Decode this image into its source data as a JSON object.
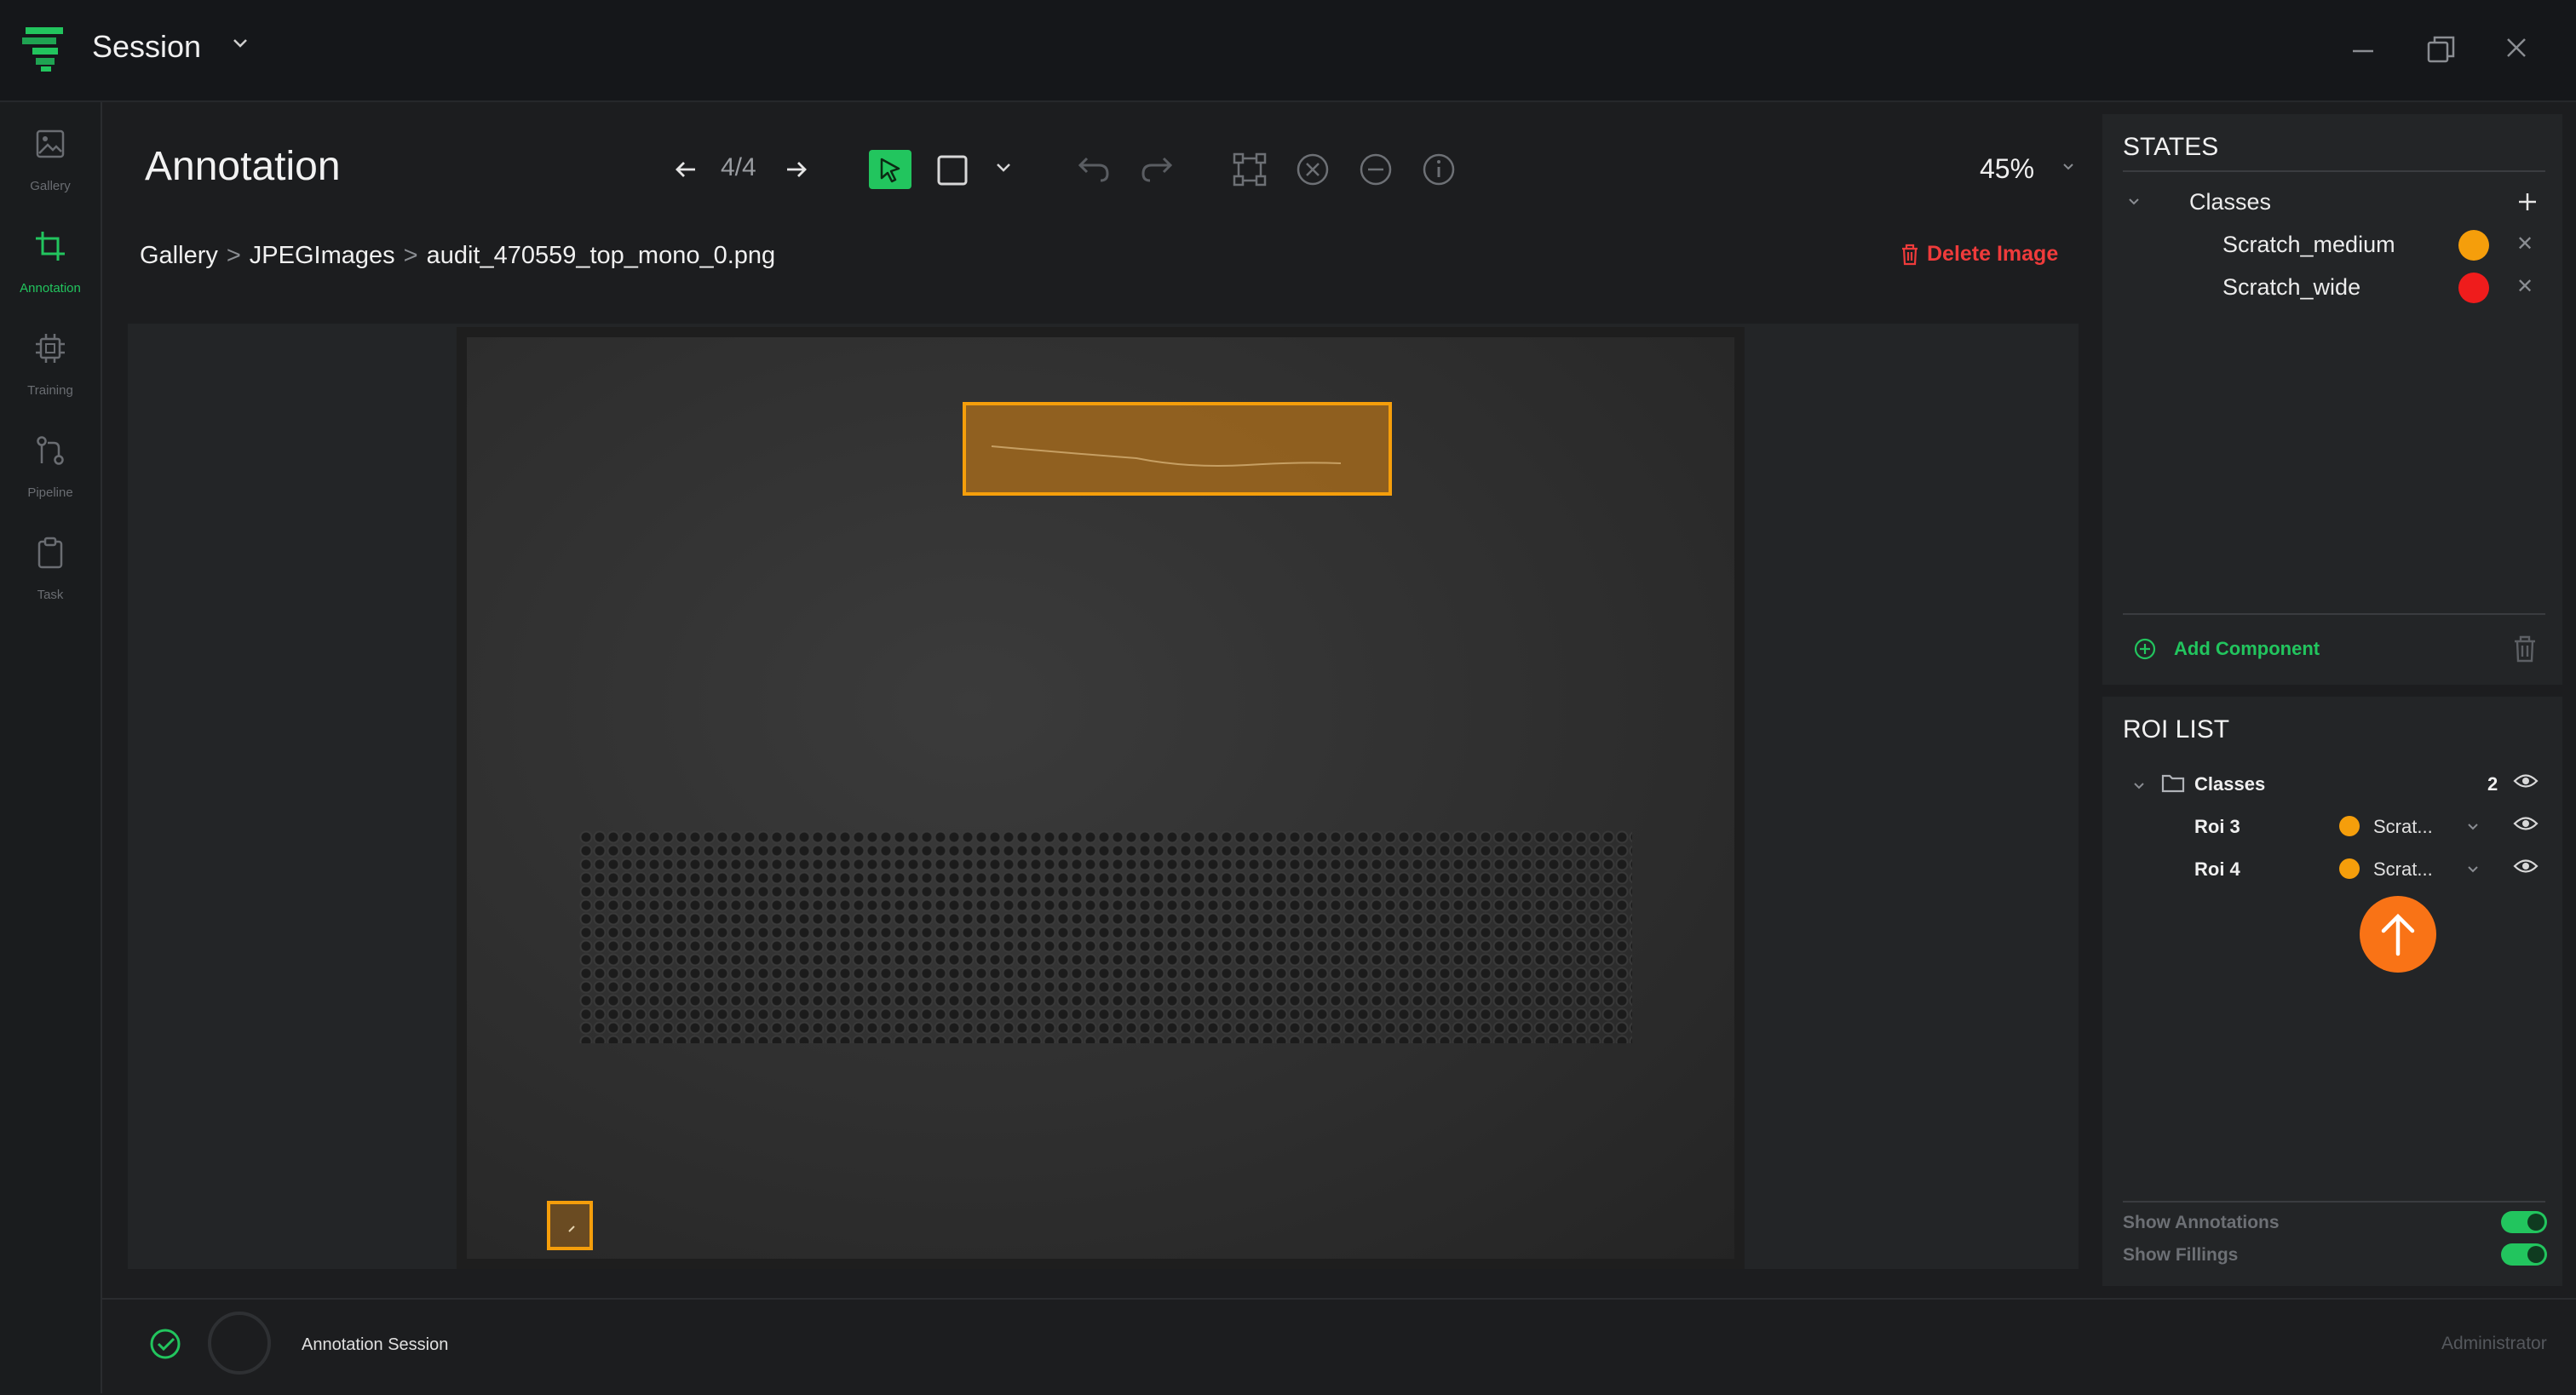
{
  "titlebar": {
    "session_title": "Session"
  },
  "nav": {
    "items": [
      {
        "label": "Gallery",
        "icon": "gallery-icon"
      },
      {
        "label": "Annotation",
        "icon": "crop-icon"
      },
      {
        "label": "Training",
        "icon": "chip-icon"
      },
      {
        "label": "Pipeline",
        "icon": "pipeline-icon"
      },
      {
        "label": "Task",
        "icon": "clipboard-icon"
      }
    ],
    "active": "Annotation"
  },
  "toolbar": {
    "heading": "Annotation",
    "counter": "4/4",
    "zoom": "45%"
  },
  "breadcrumb": {
    "items": [
      "Gallery",
      "JPEGImages",
      "audit_470559_top_mono_0.png"
    ],
    "separator": ">"
  },
  "actions": {
    "delete_image": "Delete Image"
  },
  "states": {
    "title": "STATES",
    "group_label": "Classes",
    "classes": [
      {
        "name": "Scratch_medium",
        "color": "#f59e0b"
      },
      {
        "name": "Scratch_wide",
        "color": "#ef1c1c"
      }
    ],
    "add_component": "Add Component"
  },
  "roi_list": {
    "title": "ROI LIST",
    "group_label": "Classes",
    "count": "2",
    "items": [
      {
        "name": "Roi 3",
        "class_short": "Scrat...",
        "color": "#f59e0b"
      },
      {
        "name": "Roi 4",
        "class_short": "Scrat...",
        "color": "#f59e0b"
      }
    ],
    "show_annotations": "Show Annotations",
    "show_annotations_on": true,
    "show_fillings": "Show Fillings",
    "show_fillings_on": true
  },
  "statusbar": {
    "session_label": "Annotation Session",
    "user_role": "Administrator"
  },
  "colors": {
    "accent": "#22c55e",
    "danger": "#ef3b3b",
    "roi_orange": "#f59e0b",
    "fab": "#f97316"
  }
}
